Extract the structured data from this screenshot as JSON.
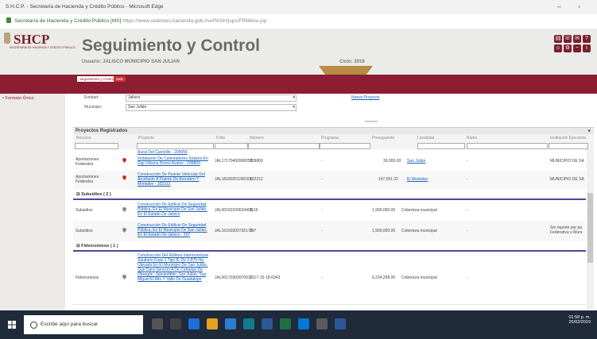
{
  "browser": {
    "title": "S.H.C.P. - Secretaría de Hacienda y Crédito Público - Microsoft Edge",
    "url_site": "Secretaría de Hacienda y Crédito Público [MX]",
    "url": "https://www.sistemas.hacienda.gob.mx/PASH/jsps/FRMenu.jsp"
  },
  "header": {
    "logo": "SHCP",
    "logo_sub": "SECRETARÍA DE HACIENDA Y CRÉDITO PÚBLICO",
    "title": "Seguimiento y Control",
    "user_label": "Usuario: JALISCO MUNICIPIO SAN JULIAN",
    "ciclo_label": "Ciclo: 2018"
  },
  "nav": {
    "tab_seguimiento": "Seguimiento y Control",
    "tab_salir": "Salir",
    "sidebar_item": "• Formato Único"
  },
  "filters": {
    "entidad_label": "Entidad:",
    "entidad_value": "Jalisco",
    "municipio_label": "Municipio:",
    "municipio_value": "San Julián",
    "link": "Nuevo Proyecto"
  },
  "grid": {
    "title": "Proyectos Registrados",
    "columns": [
      "Recurso",
      "Proyecto",
      "Folio",
      "Número",
      "Programa",
      "Presupuesto",
      "Localidad",
      "Ramo",
      "Institución Ejecutora"
    ],
    "partial_row": "Rural Del Carrizillo - 209056",
    "rows": [
      {
        "recurso": "Aportaciones Federales",
        "proyecto": "Instalación De Calentadores Solares En Zap Urbana Pozos Avalos - 209809",
        "folio": "JAL17170400998259",
        "numero": "209809",
        "programa": "-",
        "presupuesto": "39,000.00",
        "localidad": "San Julián",
        "ramo": "-",
        "institucion": "MUNICIPIO DE SA"
      },
      {
        "recurso": "Aportaciones Federales",
        "proyecto": "Construcción De Puente Vehicular Del Arcoiluido A Puente De Arreolero Y Montalvo - 102212",
        "folio": "JAL18180201095306",
        "numero": "102212",
        "programa": "-",
        "presupuesto": "147,551.32",
        "localidad": "El Montalvo",
        "ramo": "-",
        "institucion": "MUNICIPIO DE SA"
      }
    ],
    "group_subsidios": "Subsidios ( 2 )",
    "subsidios_rows": [
      {
        "recurso": "Subsidios",
        "proyecto": "Construcción De Edificio De Seguridad Pública, En El Municipio De San Julián, En El Estado De Jalisco",
        "folio": "JAL00160100634408",
        "numero": "1119",
        "programa": "-",
        "presupuesto": "1,900,000.00",
        "localidad": "Cobertura municipal",
        "ramo": "-",
        "institucion": ""
      },
      {
        "recurso": "Subsidios",
        "proyecto": "Construcción De Edificio De Seguridad Pública, En El Municipio De San Julián, En El Estado De Jalisco - 297",
        "folio": "JAL16160300735176",
        "numero": "297",
        "programa": "-",
        "presupuesto": "1,900,000.00",
        "localidad": "Cobertura municipal",
        "ramo": "-",
        "institucion": "Sin reporte por pa Federativa o Muni"
      }
    ],
    "group_fideicomisos": "Fideicomisos ( 1 )",
    "fideicomisos_rows": [
      {
        "recurso": "Fideicomisos",
        "proyecto": "Construcción Del Relleno Intermunicipal Sanitario Fase 1 Tipo B, De 0.875 Ha. Ubicado En El Municipio De San Julián, Que Dará Servicio A De Cañadas De Obregón, Jalostotitlán, San Julián, San Miguel El Alto Y Valle De Guadalupe",
        "folio": "JAL00170300970611",
        "numero": "2017-15-18-0343",
        "programa": "-",
        "presupuesto": "6,224,298.00",
        "localidad": "Cobertura municipal",
        "ramo": "-",
        "institucion": ""
      }
    ]
  },
  "taskbar": {
    "search_placeholder": "Escribe aquí para buscar",
    "time": "01:58 p. m.",
    "date": "25/02/2019"
  },
  "colors": {
    "brand": "#8c1d33",
    "accent_gold": "#b78c43"
  }
}
